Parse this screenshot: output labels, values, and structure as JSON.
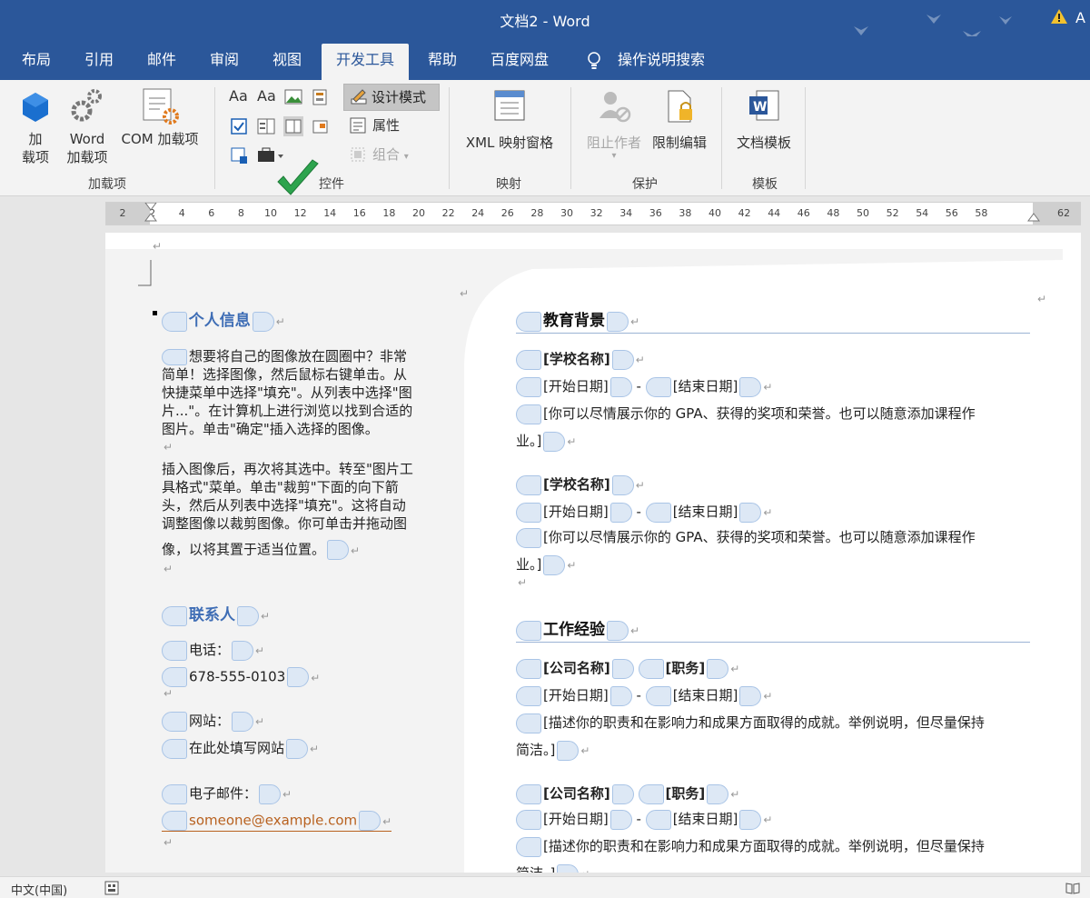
{
  "window": {
    "title": "文档2  -  Word",
    "account": "A"
  },
  "tabs": [
    {
      "label": "布局"
    },
    {
      "label": "引用"
    },
    {
      "label": "邮件"
    },
    {
      "label": "审阅"
    },
    {
      "label": "视图"
    },
    {
      "label": "开发工具"
    },
    {
      "label": "帮助"
    },
    {
      "label": "百度网盘"
    },
    {
      "label": "操作说明搜索"
    }
  ],
  "ribbon": {
    "addins": {
      "btn1": "加\n载项",
      "btn2": "Word\n加载项",
      "btn3": "COM 加载项",
      "group": "加载项"
    },
    "controls": {
      "design_mode": "设计模式",
      "properties": "属性",
      "group_btn": "组合",
      "group": "控件",
      "aa1": "Aa",
      "aa2": "Aa"
    },
    "mapping": {
      "xml": "XML 映射窗格",
      "group": "映射"
    },
    "protect": {
      "block_authors": "阻止作者",
      "restrict": "限制编辑",
      "group": "保护"
    },
    "templates": {
      "doc_template": "文档模板",
      "group": "模板"
    }
  },
  "ruler": {
    "labels": [
      "2",
      "2",
      "4",
      "6",
      "8",
      "10",
      "12",
      "14",
      "16",
      "18",
      "20",
      "22",
      "24",
      "26",
      "28",
      "30",
      "32",
      "34",
      "36",
      "38",
      "40",
      "42",
      "44",
      "46",
      "48",
      "50",
      "52",
      "54",
      "56",
      "58",
      "62"
    ]
  },
  "left": {
    "personal_title": "个人信息",
    "intro_lines": [
      "想要将自己的图像放在圆圈中？非常",
      "简单！选择图像，然后鼠标右键单击。从",
      "快捷菜单中选择\"填充\"。从列表中选择\"图",
      "片...\"。在计算机上进行浏览以找到合适的",
      "图片。单击\"确定\"插入选择的图像。"
    ],
    "para2_lines": [
      "插入图像后，再次将其选中。转至\"图片工",
      "具格式\"菜单。单击\"裁剪\"下面的向下箭",
      "头，然后从列表中选择\"填充\"。这将自动",
      "调整图像以裁剪图像。你可单击并拖动图",
      "像，以将其置于适当位置。"
    ],
    "contact_title": "联系人",
    "phone_label": "电话：",
    "phone": "678-555-0103",
    "website_label": "网站：",
    "website": "在此处填写网站",
    "email_label": "电子邮件：",
    "email": "someone@example.com"
  },
  "right": {
    "edu_title": "教育背景",
    "school": "[学校名称]",
    "start": "[开始日期]",
    "dash": "-",
    "end": "[结束日期]",
    "edu_desc_1": "[你可以尽情展示你的 GPA、获得的奖项和荣誉。也可以随意添加课程作",
    "edu_desc_2": "业。]",
    "work_title": "工作经验",
    "company": "[公司名称]",
    "position": "[职务]",
    "work_desc_1": "[描述你的职责和在影响力和成果方面取得的成就。举例说明，但尽量保持",
    "work_desc_2": "简洁。]",
    "work_desc_2b": "简洁。]"
  },
  "status": {
    "language": "中文(中国)"
  },
  "colors": {
    "brand": "#2b579a",
    "heading_left": "#3e6db5",
    "email": "#b8611f",
    "check": "#2da44e"
  }
}
